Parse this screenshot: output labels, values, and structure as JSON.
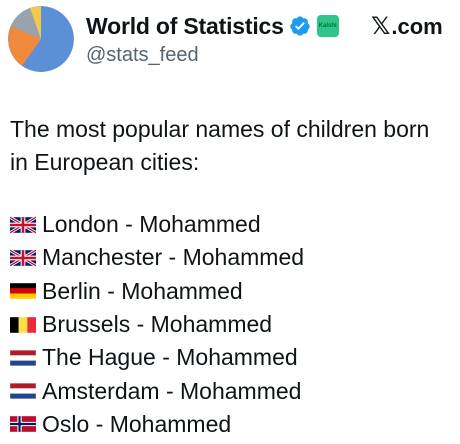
{
  "account": {
    "display_name": "World of Statistics",
    "handle": "@stats_feed",
    "affiliate_badge": "Kalshi",
    "brand_suffix": ".com",
    "brand_glyph": "𝕏",
    "avatar_colors": [
      "#5b8fd6",
      "#ef8a3c",
      "#9aa3ad",
      "#f2c94c"
    ]
  },
  "post": {
    "intro": "The most popular names of children born in European cities:",
    "items": [
      {
        "flag": "uk-flag-icon",
        "text": "London - Mohammed"
      },
      {
        "flag": "uk-flag-icon",
        "text": "Manchester - Mohammed"
      },
      {
        "flag": "germany-flag-icon",
        "text": "Berlin - Mohammed"
      },
      {
        "flag": "belgium-flag-icon",
        "text": "Brussels - Mohammed"
      },
      {
        "flag": "netherlands-flag-icon",
        "text": "The Hague - Mohammed"
      },
      {
        "flag": "netherlands-flag-icon",
        "text": "Amsterdam - Mohammed"
      },
      {
        "flag": "norway-flag-icon",
        "text": "Oslo - Mohammed"
      }
    ]
  },
  "colors": {
    "verified": "#1d9bf0",
    "affiliate": "#2ec58a",
    "text": "#0f1419",
    "secondary_text": "#536471"
  }
}
